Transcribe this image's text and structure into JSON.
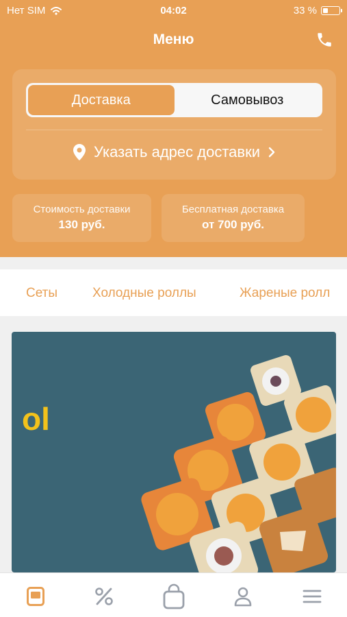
{
  "status_bar": {
    "carrier": "Нет SIM",
    "time": "04:02",
    "battery": "33 %"
  },
  "nav": {
    "title": "Меню",
    "phone_icon": "phone-icon"
  },
  "delivery_toggle": {
    "delivery_label": "Доставка",
    "pickup_label": "Самовывоз",
    "selected": "delivery"
  },
  "address": {
    "label": "Указать адрес доставки",
    "icon": "location-pin-icon"
  },
  "info_cards": [
    {
      "label": "Стоимость доставки",
      "value": "130 руб."
    },
    {
      "label": "Бесплатная доставка",
      "value": "от 700 руб."
    }
  ],
  "categories": [
    "Сеты",
    "Холодные роллы",
    "Жареные ролл"
  ],
  "banner": {
    "text": "ol"
  },
  "tab_bar": [
    "menu-icon",
    "percent-icon",
    "bag-icon",
    "user-icon",
    "hamburger-icon"
  ],
  "colors": {
    "accent": "#e8a055",
    "banner_bg": "#3b6575",
    "banner_text": "#f3c21b",
    "tab_inactive": "#9aa0aa"
  }
}
